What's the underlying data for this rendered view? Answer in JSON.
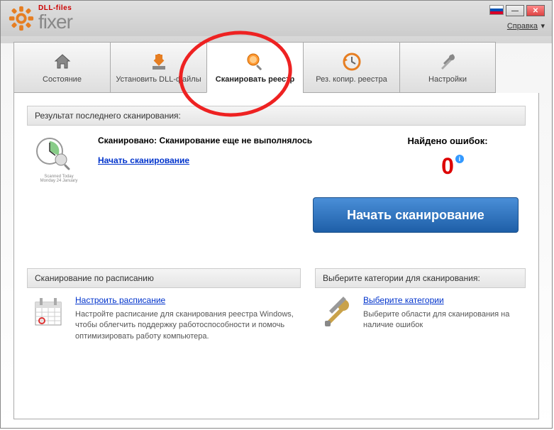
{
  "logo": {
    "brand": "DLL-files",
    "name": "fixer"
  },
  "titlebar": {
    "help": "Справка",
    "helpArrow": "▾"
  },
  "tabs": [
    {
      "label": "Состояние"
    },
    {
      "label": "Установить DLL-файлы"
    },
    {
      "label": "Сканировать реестр"
    },
    {
      "label": "Рез. копир. реестра"
    },
    {
      "label": "Настройки"
    }
  ],
  "result": {
    "header": "Результат последнего сканирования:",
    "scannedLabel": "Сканировано: ",
    "scannedValue": "Сканирование еще не выполнялось",
    "startLink": "Начать сканирование",
    "iconCaption1": "Scanned Today",
    "iconCaption2": "Monday 24 January"
  },
  "errors": {
    "label": "Найдено ошибок:",
    "count": "0",
    "info": "i"
  },
  "mainButton": "Начать сканирование",
  "schedule": {
    "header": "Сканирование по расписанию",
    "link": "Настроить расписание",
    "desc": "Настройте расписание для сканирования реестра Windows, чтобы облегчить поддержку работоспособности и помочь оптимизировать работу компьютера."
  },
  "categories": {
    "header": "Выберите категории для сканирования:",
    "link": "Выберите категории",
    "desc": "Выберите области для сканирования на наличие ошибок"
  }
}
